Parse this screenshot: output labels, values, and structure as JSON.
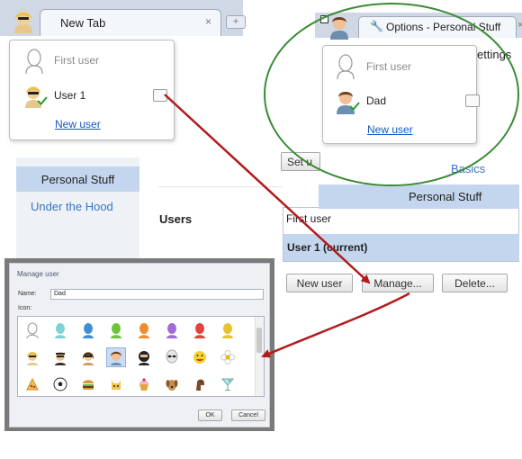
{
  "left_browser": {
    "tab_title": "New Tab",
    "tab_close": "×",
    "new_tab_button": "+",
    "menu": {
      "items": [
        {
          "name": "First user",
          "active": false
        },
        {
          "name": "User 1",
          "active": true
        }
      ],
      "new_user_link": "New user"
    }
  },
  "settings": {
    "nav": {
      "personal_stuff": "Personal Stuff",
      "under_the_hood": "Under the Hood"
    },
    "users_heading": "Users",
    "users_list": [
      "First user",
      "User 1 (current)"
    ],
    "buttons": {
      "new_user": "New user",
      "manage": "Manage...",
      "delete": "Delete..."
    },
    "partial_button": "Set u"
  },
  "right_browser": {
    "tab_title": "Options - Personal Stuff",
    "tab_close": "×",
    "menu": {
      "items": [
        {
          "name": "First user",
          "active": false
        },
        {
          "name": "Dad",
          "active": true
        }
      ],
      "new_user_link": "New user"
    },
    "settings_partial": "ettings",
    "nav_basics": "Basics",
    "nav_personal": "Personal Stuff"
  },
  "manage_dialog": {
    "title": "Manage user",
    "name_label": "Name:",
    "name_value": "Dad",
    "icon_label": "Icon:",
    "ok": "OK",
    "cancel": "Cancel"
  },
  "colors": {
    "highlight_ellipse": "#3a8a35",
    "arrow": "#b31b1b",
    "selection": "#c4d6ee",
    "link": "#1a55c9"
  }
}
